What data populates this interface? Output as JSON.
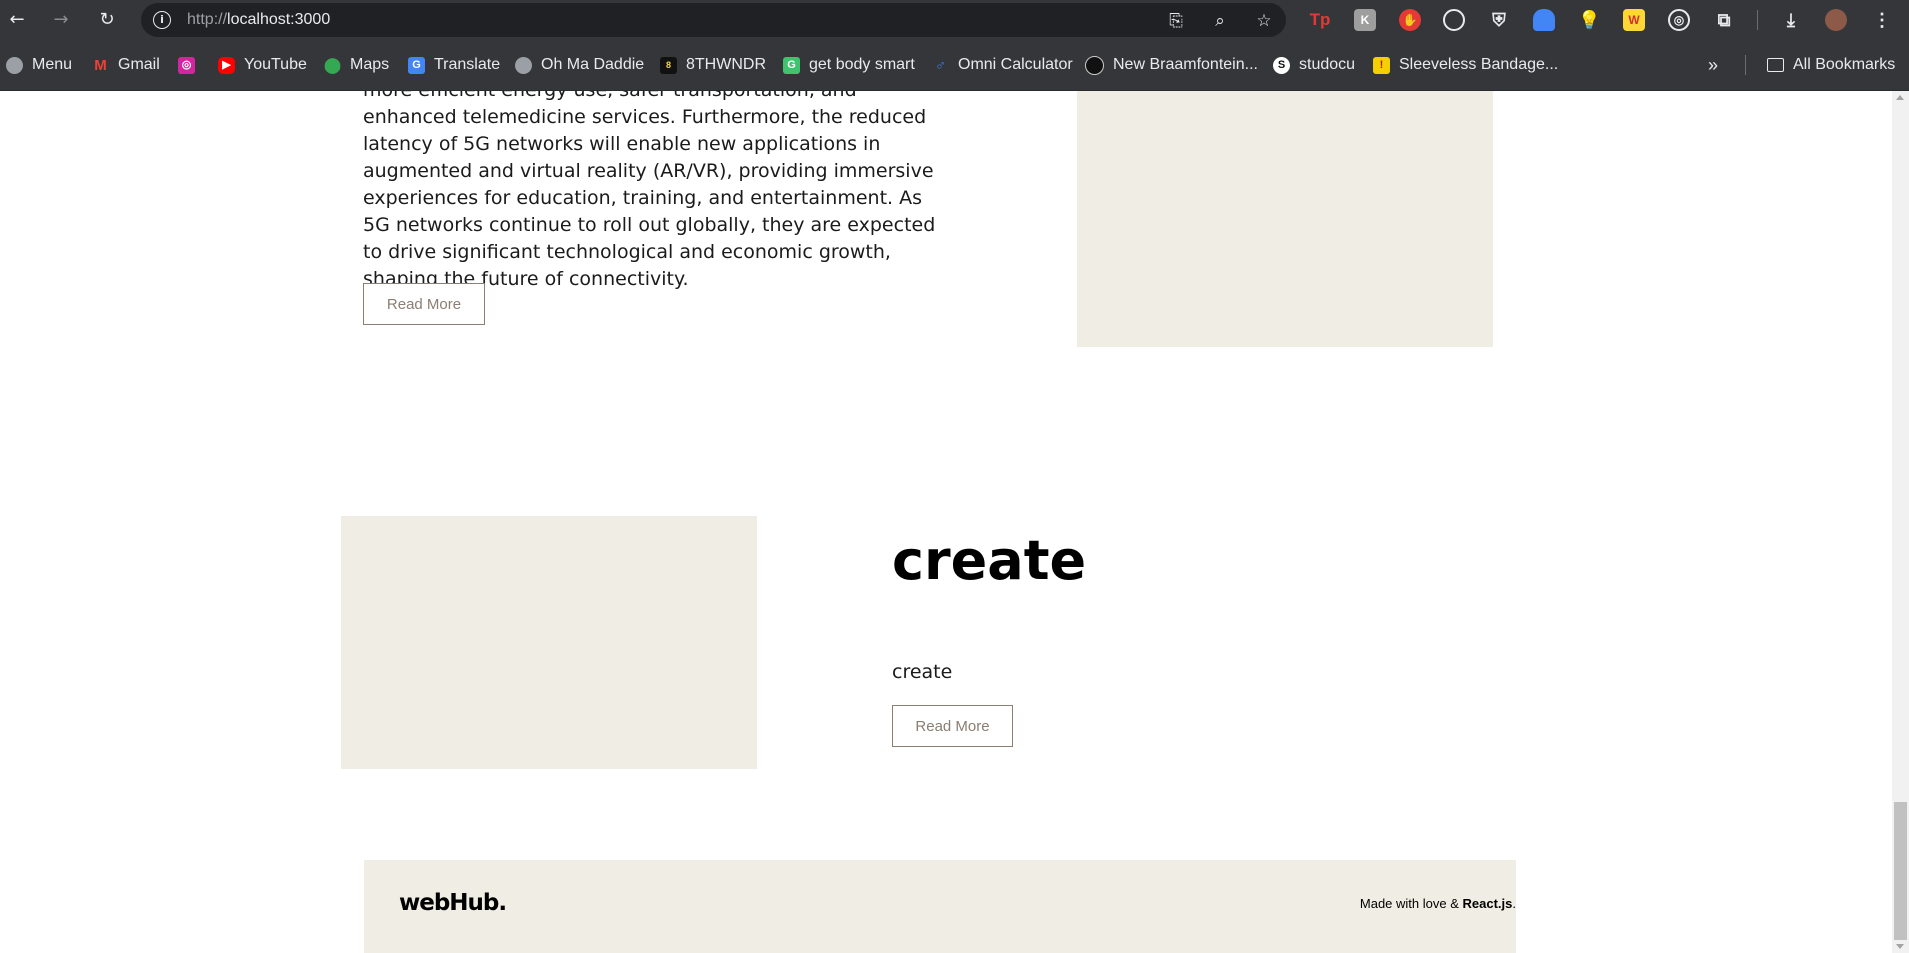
{
  "browser": {
    "url_prefix": "http://",
    "url_host": "localhost:3000",
    "bookmarks": [
      {
        "label": "Menu",
        "icon": "globe-icon"
      },
      {
        "label": "Gmail",
        "icon": "gmail-icon"
      },
      {
        "label": "",
        "icon": "instagram-icon"
      },
      {
        "label": "YouTube",
        "icon": "youtube-icon"
      },
      {
        "label": "Maps",
        "icon": "maps-icon"
      },
      {
        "label": "Translate",
        "icon": "translate-icon"
      },
      {
        "label": "Oh Ma Daddie",
        "icon": "globe-icon"
      },
      {
        "label": "8THWNDR",
        "icon": "8thwndr-icon"
      },
      {
        "label": "get body smart",
        "icon": "getbodysmart-icon"
      },
      {
        "label": "Omni Calculator",
        "icon": "omni-icon"
      },
      {
        "label": "New Braamfontein...",
        "icon": "braamfontein-icon"
      },
      {
        "label": "studocu",
        "icon": "studocu-icon"
      },
      {
        "label": "Sleeveless Bandage...",
        "icon": "bandage-icon"
      }
    ],
    "all_bookmarks_label": "All Bookmarks",
    "ext_tp": "Tp"
  },
  "article1": {
    "paragraph": "more efficient energy use, safer transportation, and enhanced telemedicine services. Furthermore, the reduced latency of 5G networks will enable new applications in augmented and virtual reality (AR/VR), providing immersive experiences for education, training, and entertainment. As 5G networks continue to roll out globally, they are expected to drive significant technological and economic growth, shaping the future of connectivity.",
    "button_label": "Read More"
  },
  "article2": {
    "title": "create",
    "summary": "create",
    "button_label": "Read More"
  },
  "footer": {
    "logo": "webHub.",
    "credit_prefix": "Made with love & ",
    "credit_tech": "React.js",
    "credit_suffix": "."
  }
}
